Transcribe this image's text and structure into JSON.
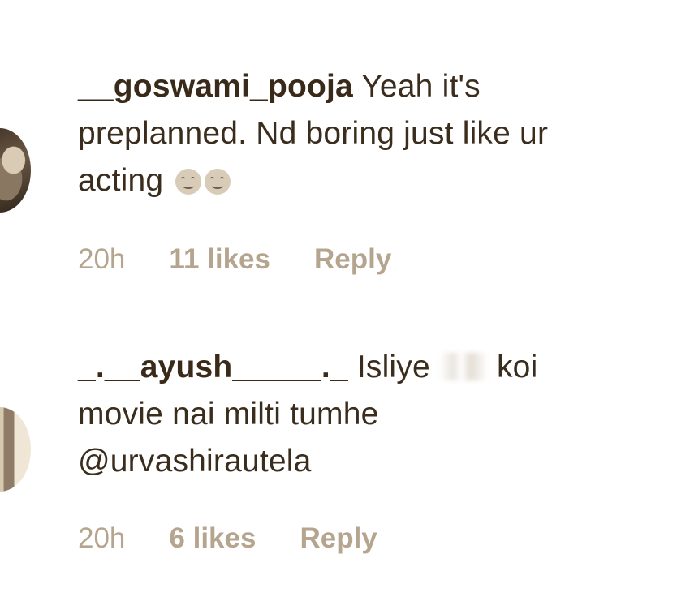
{
  "comments": [
    {
      "username": "__goswami_pooja",
      "text_line1": " Yeah it's",
      "text_line2": "preplanned. Nd boring just like ur",
      "text_line3": "acting ",
      "emojis": [
        "smirk-face-icon",
        "smirk-face-icon"
      ],
      "time": "20h",
      "likes": "11 likes",
      "reply": "Reply"
    },
    {
      "username": "_.__ayush_____._",
      "text_line1a": " Isliye ",
      "text_line1b": " koi",
      "text_line2": "movie nai milti tumhe",
      "text_line3": "@urvashirautela",
      "time": "20h",
      "likes": "6 likes",
      "reply": "Reply"
    }
  ]
}
